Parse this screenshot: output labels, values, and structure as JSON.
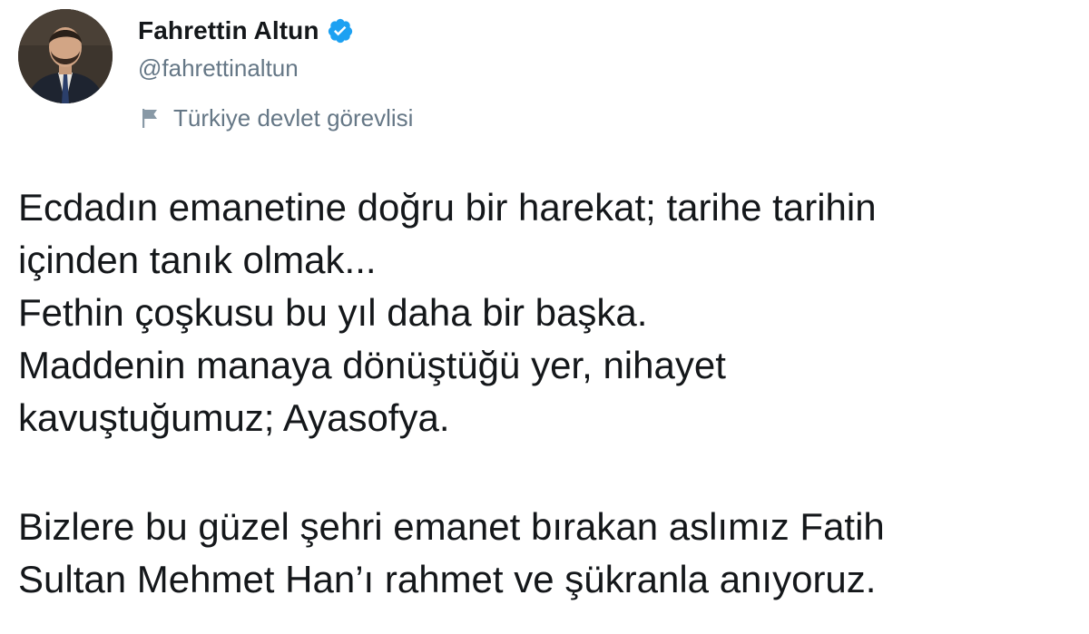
{
  "author": {
    "display_name": "Fahrettin Altun",
    "handle": "@fahrettinaltun",
    "account_label": "Türkiye devlet görevlisi",
    "verified": true,
    "icons": {
      "verified": "verified-badge-icon",
      "label": "flag-icon"
    },
    "colors": {
      "verified_badge": "#1da1f2",
      "secondary_text": "#657786",
      "primary_text": "#14171a"
    }
  },
  "tweet": {
    "lines": [
      "Ecdadın emanetine doğru bir harekat; tarihe tarihin",
      "içinden tanık olmak...",
      "Fethin çoşkusu bu yıl daha bir başka.",
      "Maddenin manaya dönüştüğü yer, nihayet",
      "kavuştuğumuz; Ayasofya.",
      "",
      "Bizlere bu güzel şehri emanet bırakan aslımız Fatih",
      "Sultan Mehmet Han’ı rahmet ve şükranla anıyoruz."
    ]
  }
}
